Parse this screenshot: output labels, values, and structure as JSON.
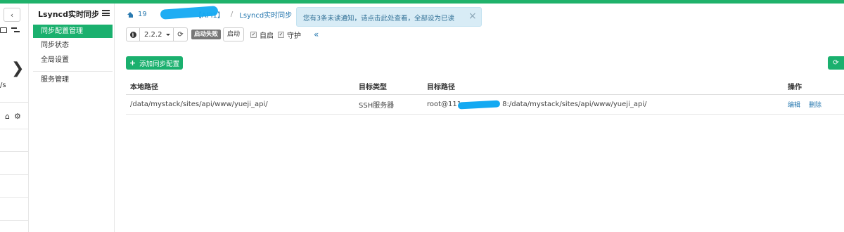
{
  "colors": {
    "accent": "#1ab06e",
    "link": "#2a7ab0",
    "notice_bg": "#d8ecf6"
  },
  "leftbar": {
    "back_label": "‹",
    "chevron": "❯",
    "label_fragment": "/s",
    "icons": [
      "terminal-icon",
      "sliders-icon",
      "home-icon",
      "gear-icon"
    ]
  },
  "subnav": {
    "title": "Lsyncd实时同步",
    "items": [
      {
        "label": "同步配置管理"
      },
      {
        "label": "同步状态"
      },
      {
        "label": "全局设置"
      },
      {
        "label": "服务管理"
      }
    ]
  },
  "breadcrumb": {
    "part1": "19",
    "part2": "【API1】",
    "sep": "/",
    "part3": "Lsyncd实时同步",
    "sep2": "/"
  },
  "notice": {
    "text": "您有3条未读通知，请点击此处查看，全部设为已读",
    "close": "×"
  },
  "toolbar": {
    "info": "i",
    "version": "2.2.2",
    "refresh": "⟳",
    "status_badge": "启动失败",
    "start_button": "启动",
    "check1": "自启",
    "check2": "守护",
    "collapse": "«"
  },
  "actions": {
    "add_label": "添加同步配置",
    "right_icon": "⟳"
  },
  "table": {
    "headers": [
      "本地路径",
      "目标类型",
      "目标路径",
      "操作"
    ],
    "rows": [
      {
        "local": "/data/mystack/sites/api/www/yueji_api/",
        "type": "SSH服务器",
        "target_prefix": "root@111",
        "target_suffix": "8:/data/mystack/sites/api/www/yueji_api/",
        "edit": "编辑",
        "delete": "删除"
      }
    ]
  }
}
